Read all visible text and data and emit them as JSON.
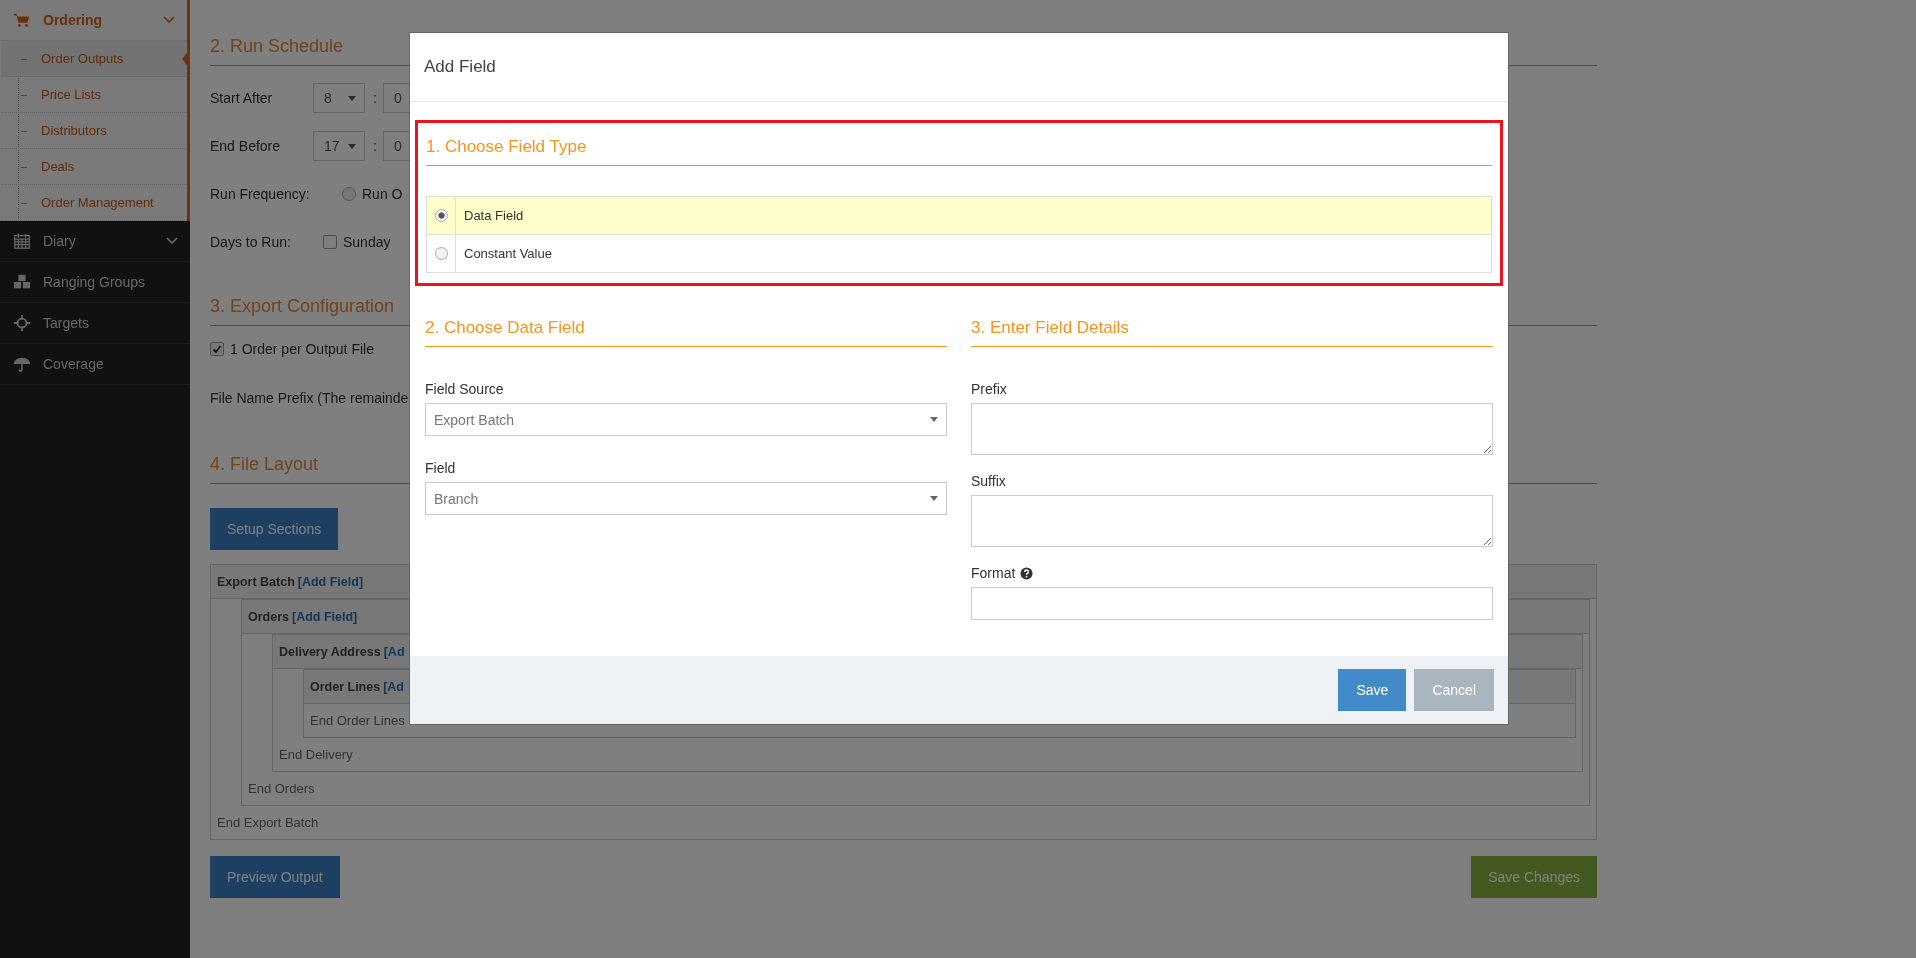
{
  "sidebar": {
    "items": [
      {
        "label": "Ordering",
        "collapsible": true,
        "expanded": true,
        "children": [
          {
            "label": "Order Outputs",
            "selected": true
          },
          {
            "label": "Price Lists",
            "selected": false
          },
          {
            "label": "Distributors",
            "selected": false
          },
          {
            "label": "Deals",
            "selected": false
          },
          {
            "label": "Order Management",
            "selected": false
          }
        ]
      },
      {
        "label": "Diary",
        "collapsible": true,
        "expanded": false
      },
      {
        "label": "Ranging Groups",
        "collapsible": false,
        "expanded": false
      },
      {
        "label": "Targets",
        "collapsible": false,
        "expanded": false
      },
      {
        "label": "Coverage",
        "collapsible": false,
        "expanded": false
      }
    ]
  },
  "schedule": {
    "heading": "2. Run Schedule",
    "times": [
      {
        "label": "Start After",
        "hour": "8",
        "separator": ":",
        "minute": "0"
      },
      {
        "label": "End Before",
        "hour": "17",
        "separator": ":",
        "minute": "0"
      }
    ],
    "frequency": {
      "label": "Run Frequency:",
      "option": "Run O",
      "selected": false
    },
    "days": {
      "label": "Days to Run:",
      "option": "Sunday",
      "checked": false
    }
  },
  "export_config": {
    "heading": "3. Export Configuration",
    "one_order": {
      "label": "1 Order per Output File",
      "checked": true
    },
    "prefix_label": "File Name Prefix (The remainde"
  },
  "file_layout": {
    "heading": "4. File Layout",
    "setup_button": "Setup Sections",
    "tree": {
      "title": "Export Batch",
      "link": "[Add Field]",
      "end": "End Export Batch",
      "children": [
        {
          "title": "Orders",
          "link": "[Add Field]",
          "end": "End Orders",
          "children": [
            {
              "title": "Delivery Address",
              "link": "[Ad",
              "end": "End Delivery",
              "children": [
                {
                  "title": "Order Lines",
                  "link": "[Ad",
                  "end": "End Order Lines"
                }
              ]
            }
          ]
        }
      ]
    },
    "preview_button": "Preview Output",
    "save_button": "Save Changes"
  },
  "modal": {
    "title": "Add Field",
    "field_type": {
      "heading": "1. Choose Field Type",
      "options": [
        {
          "label": "Data Field",
          "selected": true
        },
        {
          "label": "Constant Value",
          "selected": false
        }
      ]
    },
    "data_field": {
      "heading": "2. Choose Data Field",
      "selects": [
        {
          "label": "Field Source",
          "value": "Export Batch"
        },
        {
          "label": "Field",
          "value": "Branch"
        }
      ]
    },
    "details": {
      "heading": "3. Enter Field Details",
      "fields": [
        {
          "label": "Prefix",
          "kind": "textarea",
          "help": false
        },
        {
          "label": "Suffix",
          "kind": "textarea",
          "help": false
        },
        {
          "label": "Format",
          "kind": "input",
          "help": true
        }
      ]
    },
    "buttons": [
      {
        "label": "Save",
        "kind": "primary"
      },
      {
        "label": "Cancel",
        "kind": "secondary"
      }
    ]
  }
}
